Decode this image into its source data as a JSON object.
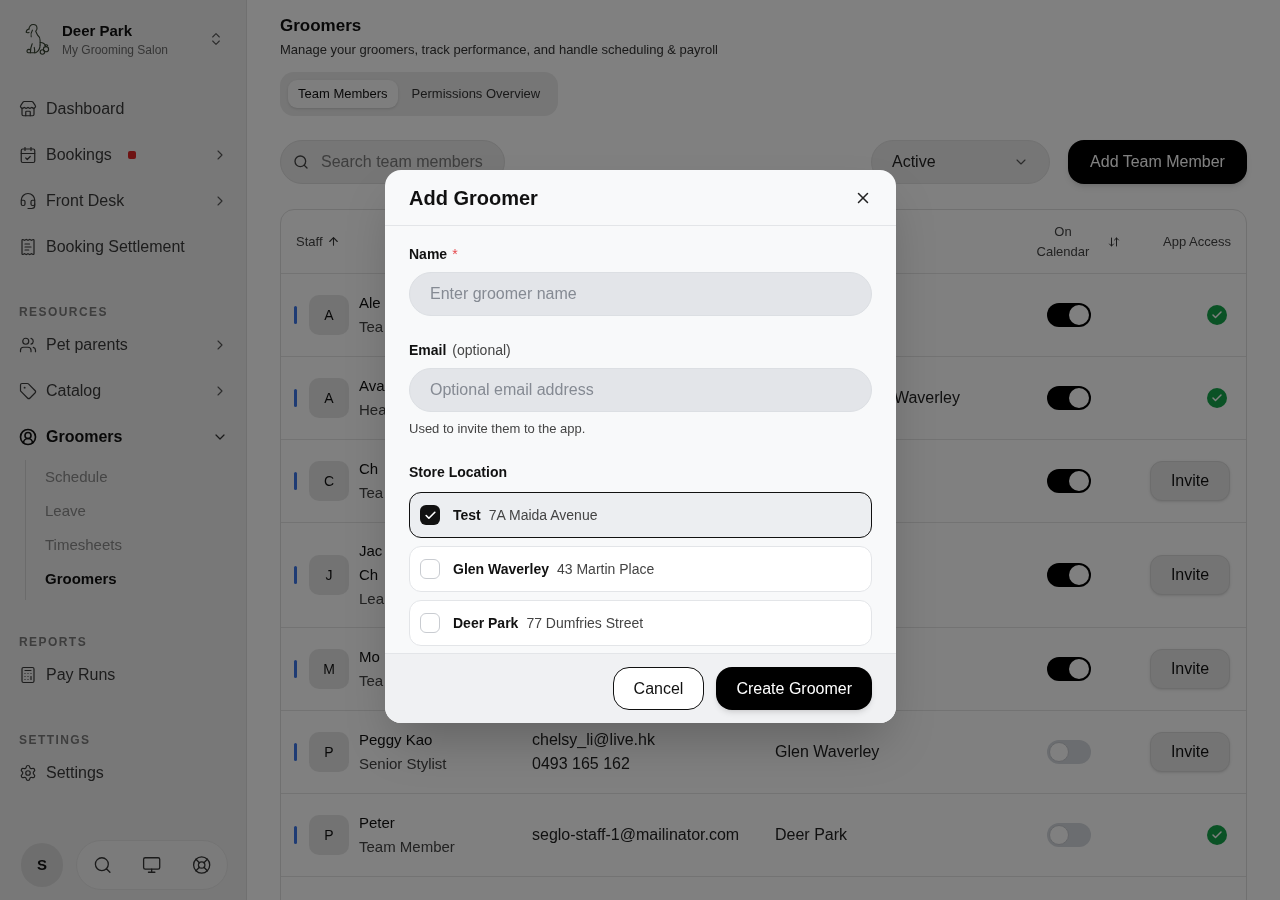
{
  "sidebar": {
    "store": {
      "name": "Deer Park",
      "subtitle": "My Grooming Salon"
    },
    "sections": [
      {
        "items": [
          {
            "label": "Dashboard",
            "selected": false,
            "alert": false
          },
          {
            "label": "Bookings",
            "selected": false,
            "alert": true,
            "expanded": false
          },
          {
            "label": "Front Desk",
            "selected": false,
            "alert": false,
            "expanded": false
          },
          {
            "label": "Booking Settlement",
            "selected": false,
            "alert": false
          }
        ]
      },
      {
        "label": "RESOURCES",
        "items": [
          {
            "label": "Pet parents",
            "selected": false,
            "expanded": false
          },
          {
            "label": "Catalog",
            "selected": false,
            "expanded": false
          },
          {
            "label": "Groomers",
            "selected": true,
            "expanded": true,
            "children": [
              {
                "label": "Schedule",
                "selected": false
              },
              {
                "label": "Leave",
                "selected": false
              },
              {
                "label": "Timesheets",
                "selected": false
              },
              {
                "label": "Groomers",
                "selected": true
              }
            ]
          }
        ]
      },
      {
        "label": "REPORTS",
        "items": [
          {
            "label": "Pay Runs",
            "selected": false
          }
        ]
      },
      {
        "label": "SETTINGS",
        "items": [
          {
            "label": "Settings",
            "selected": false
          }
        ]
      }
    ],
    "user_avatar": "S"
  },
  "header": {
    "title": "Groomers",
    "subtitle": "Manage your groomers, track performance, and handle scheduling & payroll"
  },
  "tabs": [
    {
      "label": "Team Members",
      "selected": true
    },
    {
      "label": "Permissions Overview",
      "selected": false
    }
  ],
  "toolbar": {
    "search": {
      "placeholder": "Search team members"
    },
    "status_filter": {
      "value": "Active"
    },
    "add_button": "Add Team Member"
  },
  "table": {
    "columns": [
      {
        "label": "Staff",
        "sorted": true
      },
      {
        "label": "On Calendar",
        "sorted": false
      },
      {
        "label": "App Access"
      }
    ],
    "rows": [
      {
        "initial": "A",
        "name_lines": [
          "Ale"
        ],
        "role": "Tea",
        "covered": true,
        "on_calendar": true,
        "app_access": {
          "kind": "granted"
        }
      },
      {
        "initial": "A",
        "name_lines": [
          "Ava"
        ],
        "role": "Hea",
        "covered": true,
        "location": "Waverley",
        "on_calendar": true,
        "app_access": {
          "kind": "granted"
        }
      },
      {
        "initial": "C",
        "name_lines": [
          "Ch"
        ],
        "role": "Tea",
        "covered": true,
        "on_calendar": true,
        "app_access": {
          "kind": "invite",
          "label": "Invite"
        }
      },
      {
        "initial": "J",
        "name_lines": [
          "Jac",
          "Ch"
        ],
        "role": "Lea",
        "covered": true,
        "on_calendar": true,
        "app_access": {
          "kind": "invite",
          "label": "Invite"
        }
      },
      {
        "initial": "M",
        "name_lines": [
          "Mo"
        ],
        "role": "Tea",
        "covered": true,
        "on_calendar": true,
        "app_access": {
          "kind": "invite",
          "label": "Invite"
        }
      },
      {
        "initial": "P",
        "name_lines": [
          "Peggy Kao"
        ],
        "role": "Senior Stylist",
        "covered": false,
        "email": "chelsy_li@live.hk",
        "phone": "0493 165 162",
        "location": "Glen Waverley",
        "on_calendar": false,
        "app_access": {
          "kind": "invite",
          "label": "Invite"
        }
      },
      {
        "initial": "P",
        "name_lines": [
          "Peter"
        ],
        "role": "Team Member",
        "covered": false,
        "email": "seglo-staff-1@mailinator.com",
        "location": "Deer Park",
        "on_calendar": false,
        "app_access": {
          "kind": "granted"
        }
      }
    ]
  },
  "dialog": {
    "title": "Add Groomer",
    "fields": [
      {
        "label": "Name",
        "required_mark": "*",
        "placeholder": "Enter groomer name"
      },
      {
        "label": "Email",
        "note": "(optional)",
        "placeholder": "Optional email address",
        "help": "Used to invite them to the app."
      }
    ],
    "location_label": "Store Location",
    "locations": [
      {
        "name": "Test",
        "address": "7A Maida Avenue",
        "checked": true
      },
      {
        "name": "Glen Waverley",
        "address": "43 Martin Place",
        "checked": false
      },
      {
        "name": "Deer Park",
        "address": "77 Dumfries Street",
        "checked": false
      }
    ],
    "buttons": [
      {
        "label": "Cancel",
        "kind": "secondary"
      },
      {
        "label": "Create Groomer",
        "kind": "primary"
      }
    ]
  }
}
